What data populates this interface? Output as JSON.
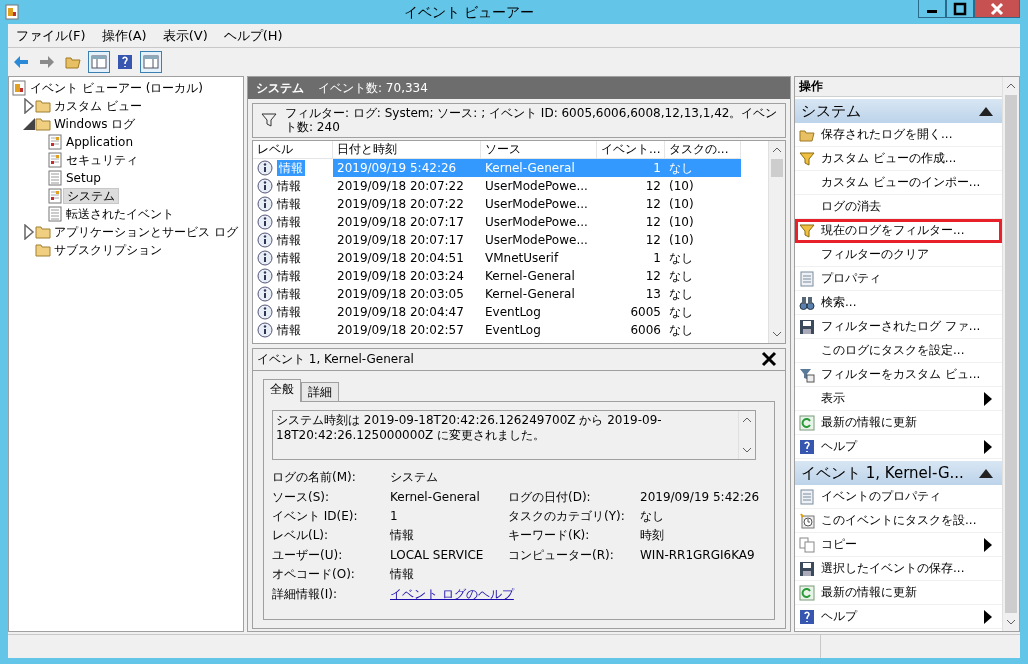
{
  "window": {
    "title": "イベント ビューアー"
  },
  "menu": [
    "ファイル(F)",
    "操作(A)",
    "表示(V)",
    "ヘルプ(H)"
  ],
  "tree": [
    {
      "label": "イベント ビューアー (ローカル)",
      "kind": "root",
      "selected": false,
      "children": [
        {
          "label": "カスタム ビュー",
          "kind": "folder",
          "expanded": false,
          "selected": false
        },
        {
          "label": "Windows ログ",
          "kind": "folder",
          "expanded": true,
          "selected": false,
          "children": [
            {
              "label": "Application",
              "kind": "log",
              "selected": false
            },
            {
              "label": "セキュリティ",
              "kind": "log",
              "selected": false
            },
            {
              "label": "Setup",
              "kind": "plainlog",
              "selected": false
            },
            {
              "label": "システム",
              "kind": "log",
              "selected": true
            },
            {
              "label": "転送されたイベント",
              "kind": "plainlog",
              "selected": false
            }
          ]
        },
        {
          "label": "アプリケーションとサービス ログ",
          "kind": "folder",
          "expanded": false,
          "selected": false
        },
        {
          "label": "サブスクリプション",
          "kind": "folder",
          "selected": false
        }
      ]
    }
  ],
  "log_header": {
    "name": "システム",
    "count": "イベント数: 70,334"
  },
  "filter_bar": "フィルター: ログ: System; ソース: ; イベント ID: 6005,6006,6008,12,13,1,42。イベント数: 240",
  "table": {
    "columns": [
      "レベル",
      "日付と時刻",
      "ソース",
      "イベント...",
      "タスクの..."
    ],
    "rows": [
      {
        "level": "情報",
        "date": "2019/09/19 5:42:26",
        "source": "Kernel-General",
        "id": "1",
        "task": "なし",
        "selected": true
      },
      {
        "level": "情報",
        "date": "2019/09/18 20:07:22",
        "source": "UserModePowe...",
        "id": "12",
        "task": "(10)",
        "selected": false
      },
      {
        "level": "情報",
        "date": "2019/09/18 20:07:22",
        "source": "UserModePowe...",
        "id": "12",
        "task": "(10)",
        "selected": false
      },
      {
        "level": "情報",
        "date": "2019/09/18 20:07:17",
        "source": "UserModePowe...",
        "id": "12",
        "task": "(10)",
        "selected": false
      },
      {
        "level": "情報",
        "date": "2019/09/18 20:07:17",
        "source": "UserModePowe...",
        "id": "12",
        "task": "(10)",
        "selected": false
      },
      {
        "level": "情報",
        "date": "2019/09/18 20:04:51",
        "source": "VMnetUserif",
        "id": "1",
        "task": "なし",
        "selected": false
      },
      {
        "level": "情報",
        "date": "2019/09/18 20:03:24",
        "source": "Kernel-General",
        "id": "12",
        "task": "なし",
        "selected": false
      },
      {
        "level": "情報",
        "date": "2019/09/18 20:03:05",
        "source": "Kernel-General",
        "id": "13",
        "task": "なし",
        "selected": false
      },
      {
        "level": "情報",
        "date": "2019/09/18 20:04:47",
        "source": "EventLog",
        "id": "6005",
        "task": "なし",
        "selected": false
      },
      {
        "level": "情報",
        "date": "2019/09/18 20:02:57",
        "source": "EventLog",
        "id": "6006",
        "task": "なし",
        "selected": false
      }
    ]
  },
  "detail": {
    "title": "イベント 1, Kernel-General",
    "tabs": [
      {
        "label": "全般",
        "selected": true
      },
      {
        "label": "詳細",
        "selected": false
      }
    ],
    "message": "システム時刻は 2019-09-18T20:42:26.126249700Z から 2019-09-18T20:42:26.125000000Z に変更されました。",
    "fields": [
      {
        "label": "ログの名前(M):",
        "value": "システム"
      },
      {
        "label": "ソース(S):",
        "value": "Kernel-General",
        "label_2": "ログの日付(D):",
        "value_2": "2019/09/19 5:42:26"
      },
      {
        "label": "イベント ID(E):",
        "value": "1",
        "label_2": "タスクのカテゴリ(Y):",
        "value_2": "なし"
      },
      {
        "label": "レベル(L):",
        "value": "情報",
        "label_2": "キーワード(K):",
        "value_2": "時刻"
      },
      {
        "label": "ユーザー(U):",
        "value": "LOCAL SERVICE",
        "label_2": "コンピューター(R):",
        "value_2": "WIN-RR1GRGI6KA9"
      },
      {
        "label": "オペコード(O):",
        "value": "情報"
      },
      {
        "label": "詳細情報(I):",
        "value": "イベント ログのヘルプ",
        "kind": "link"
      }
    ]
  },
  "actions": {
    "title": "操作",
    "sections": [
      {
        "title": "システム",
        "expanded": true,
        "items": [
          {
            "label": "保存されたログを開く...",
            "kind": "open",
            "submenu": false,
            "highlighted": false
          },
          {
            "label": "カスタム ビューの作成...",
            "kind": "filter",
            "submenu": false,
            "highlighted": false
          },
          {
            "label": "カスタム ビューのインポー...",
            "kind": "none",
            "submenu": false,
            "highlighted": false
          },
          {
            "label": "ログの消去",
            "kind": "none",
            "submenu": false,
            "highlighted": false
          },
          {
            "label": "現在のログをフィルター...",
            "kind": "filter",
            "submenu": false,
            "highlighted": true
          },
          {
            "label": "フィルターのクリア",
            "kind": "none",
            "submenu": false,
            "highlighted": false
          },
          {
            "label": "プロパティ",
            "kind": "properties",
            "submenu": false,
            "highlighted": false
          },
          {
            "label": "検索...",
            "kind": "find",
            "submenu": false,
            "highlighted": false
          },
          {
            "label": "フィルターされたログ ファ...",
            "kind": "save",
            "submenu": false,
            "highlighted": false
          },
          {
            "label": "このログにタスクを設定...",
            "kind": "none",
            "submenu": false,
            "highlighted": false
          },
          {
            "label": "フィルターをカスタム ビュ...",
            "kind": "filterview",
            "submenu": false,
            "highlighted": false
          },
          {
            "label": "表示",
            "kind": "none",
            "submenu": true,
            "highlighted": false
          },
          {
            "label": "最新の情報に更新",
            "kind": "refresh",
            "submenu": false,
            "highlighted": false
          },
          {
            "label": "ヘルプ",
            "kind": "help",
            "submenu": true,
            "highlighted": false
          }
        ]
      },
      {
        "title": "イベント 1, Kernel-G...",
        "expanded": true,
        "items": [
          {
            "label": "イベントのプロパティ",
            "kind": "properties",
            "submenu": false,
            "highlighted": false
          },
          {
            "label": "このイベントにタスクを設...",
            "kind": "task",
            "submenu": false,
            "highlighted": false
          },
          {
            "label": "コピー",
            "kind": "copy",
            "submenu": true,
            "highlighted": false
          },
          {
            "label": "選択したイベントの保存...",
            "kind": "save",
            "submenu": false,
            "highlighted": false
          },
          {
            "label": "最新の情報に更新",
            "kind": "refresh",
            "submenu": false,
            "highlighted": false
          },
          {
            "label": "ヘルプ",
            "kind": "help",
            "submenu": true,
            "highlighted": false
          }
        ]
      }
    ]
  }
}
